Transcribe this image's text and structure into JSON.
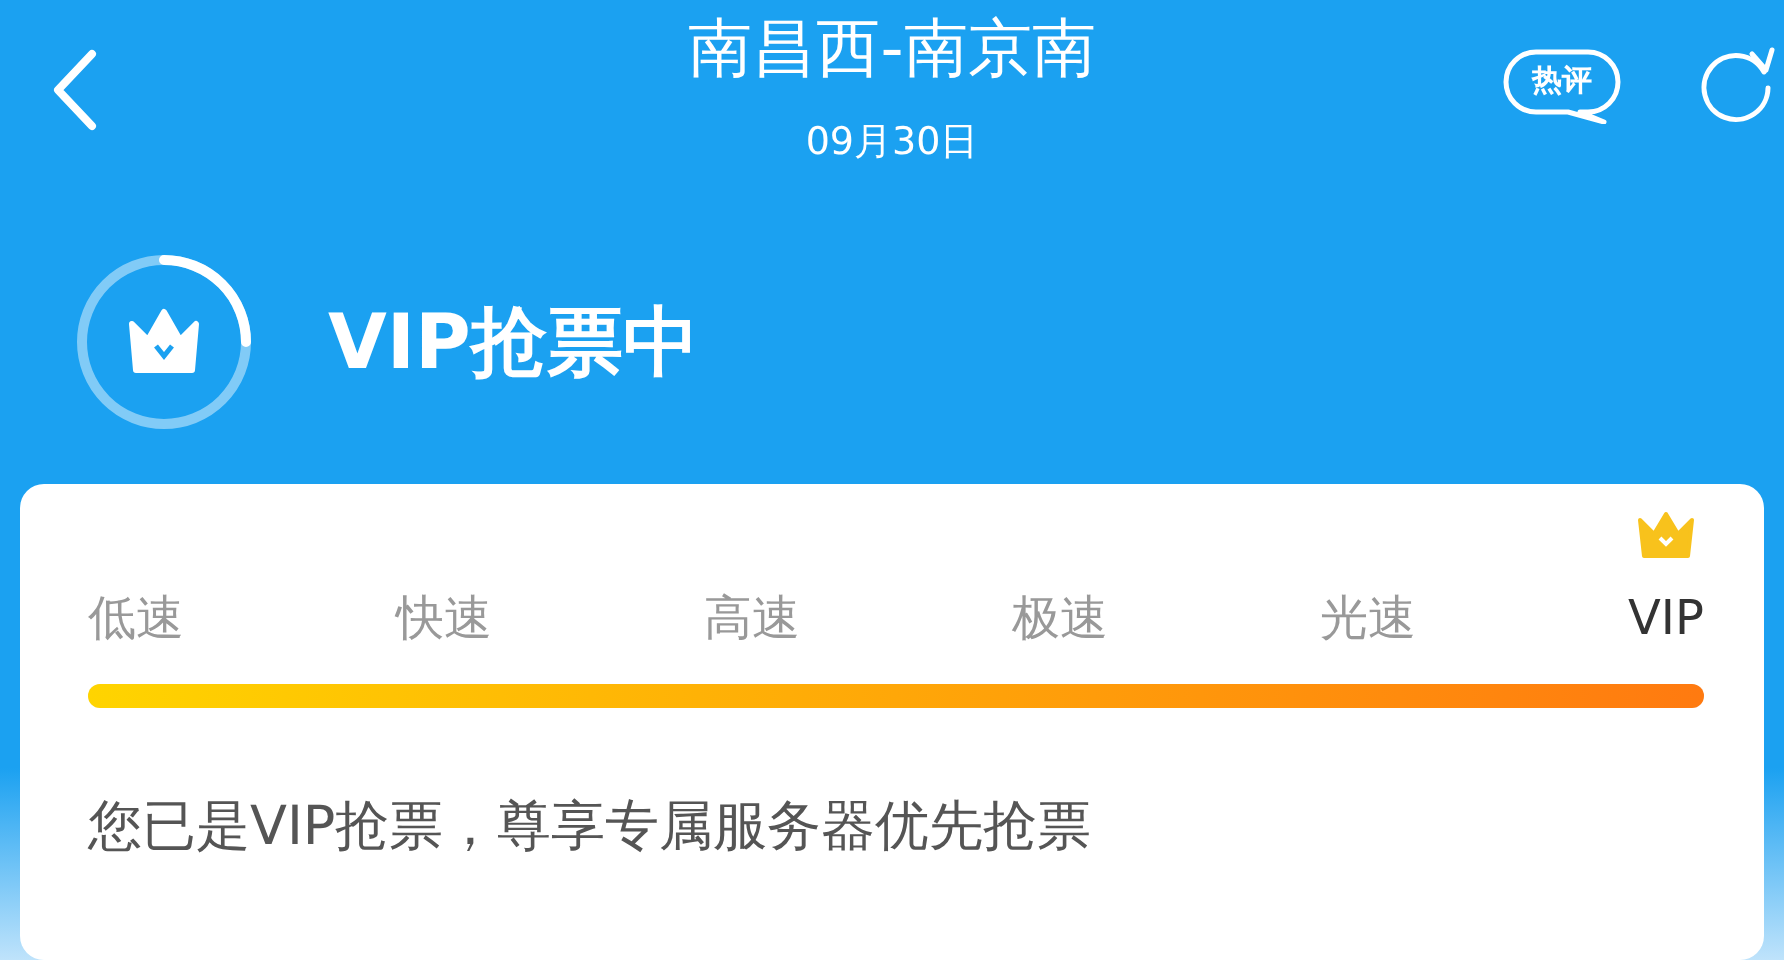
{
  "header": {
    "title": "南昌西-南京南",
    "date": "09月30日",
    "comment_badge": "热评"
  },
  "status": {
    "text": "VIP抢票中"
  },
  "speeds": [
    {
      "label": "低速",
      "selected": false
    },
    {
      "label": "快速",
      "selected": false
    },
    {
      "label": "高速",
      "selected": false
    },
    {
      "label": "极速",
      "selected": false
    },
    {
      "label": "光速",
      "selected": false
    },
    {
      "label": "VIP",
      "selected": true
    }
  ],
  "speed_bar": {
    "level": 1
  },
  "message": "您已是VIP抢票，尊享专属服务器优先抢票"
}
